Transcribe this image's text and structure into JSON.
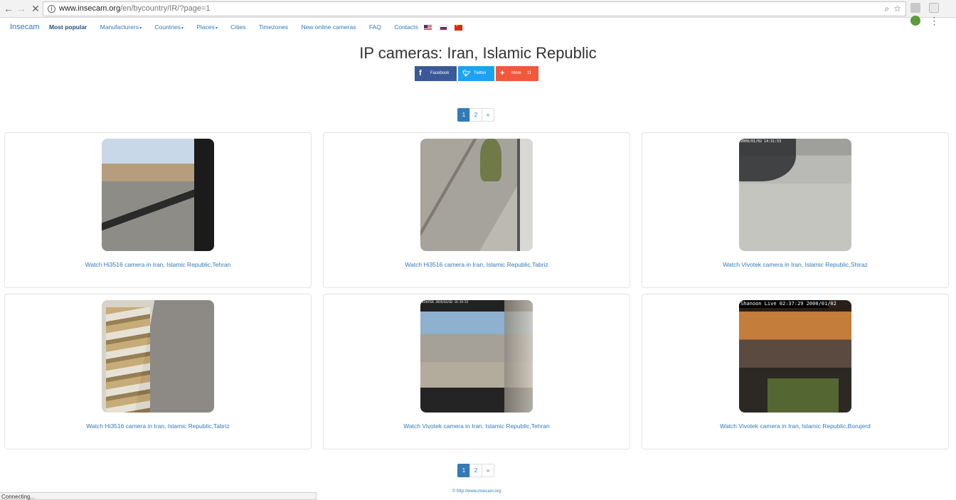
{
  "browser": {
    "url_host": "www.insecam.org",
    "url_path": "/en/bycountry/IR/?page=1",
    "status_text": "Connecting..."
  },
  "navbar": {
    "brand": "Insecam",
    "items": [
      {
        "label": "Most popular",
        "dropdown": false,
        "bold": true
      },
      {
        "label": "Manufacturers",
        "dropdown": true
      },
      {
        "label": "Countries",
        "dropdown": true
      },
      {
        "label": "Places",
        "dropdown": true
      },
      {
        "label": "Cities",
        "dropdown": false
      },
      {
        "label": "Timezones",
        "dropdown": false
      },
      {
        "label": "New online cameras",
        "dropdown": false
      },
      {
        "label": "FAQ",
        "dropdown": false
      },
      {
        "label": "Contacts",
        "dropdown": false
      }
    ],
    "flags": [
      "us-flag-icon",
      "ru-flag-icon",
      "cn-flag-icon"
    ]
  },
  "page": {
    "title": "IP cameras: Iran, Islamic Republic"
  },
  "share": {
    "facebook": "Facebook",
    "twitter": "Twitter",
    "more": "More",
    "more_count": "11"
  },
  "pagination": {
    "pages": [
      "1",
      "2"
    ],
    "active": "1",
    "next": "»"
  },
  "cameras": [
    {
      "link": "Watch Hi3516 camera in Iran, Islamic Republic,Tehran"
    },
    {
      "link": "Watch Hi3516 camera in Iran, Islamic Republic,Tabriz"
    },
    {
      "link": "Watch Vivotek camera in Iran, Islamic Republic,Shiraz",
      "overlay": "2009/01/02 14:31:53"
    },
    {
      "link": "Watch Hi3516 camera in Iran, Islamic Republic,Tabriz"
    },
    {
      "link": "Watch Vivotek camera in Iran, Islamic Republic,Tehran",
      "overlay": "VIVOTEK 2019/03/02 14:29:53"
    },
    {
      "link": "Watch Vivotek camera in Iran, Islamic Republic,Borujerd",
      "overlay": "Shanoon Live 02:37:29 2000/01/02"
    }
  ],
  "footer": {
    "text": "© http://www.insecam.org"
  }
}
